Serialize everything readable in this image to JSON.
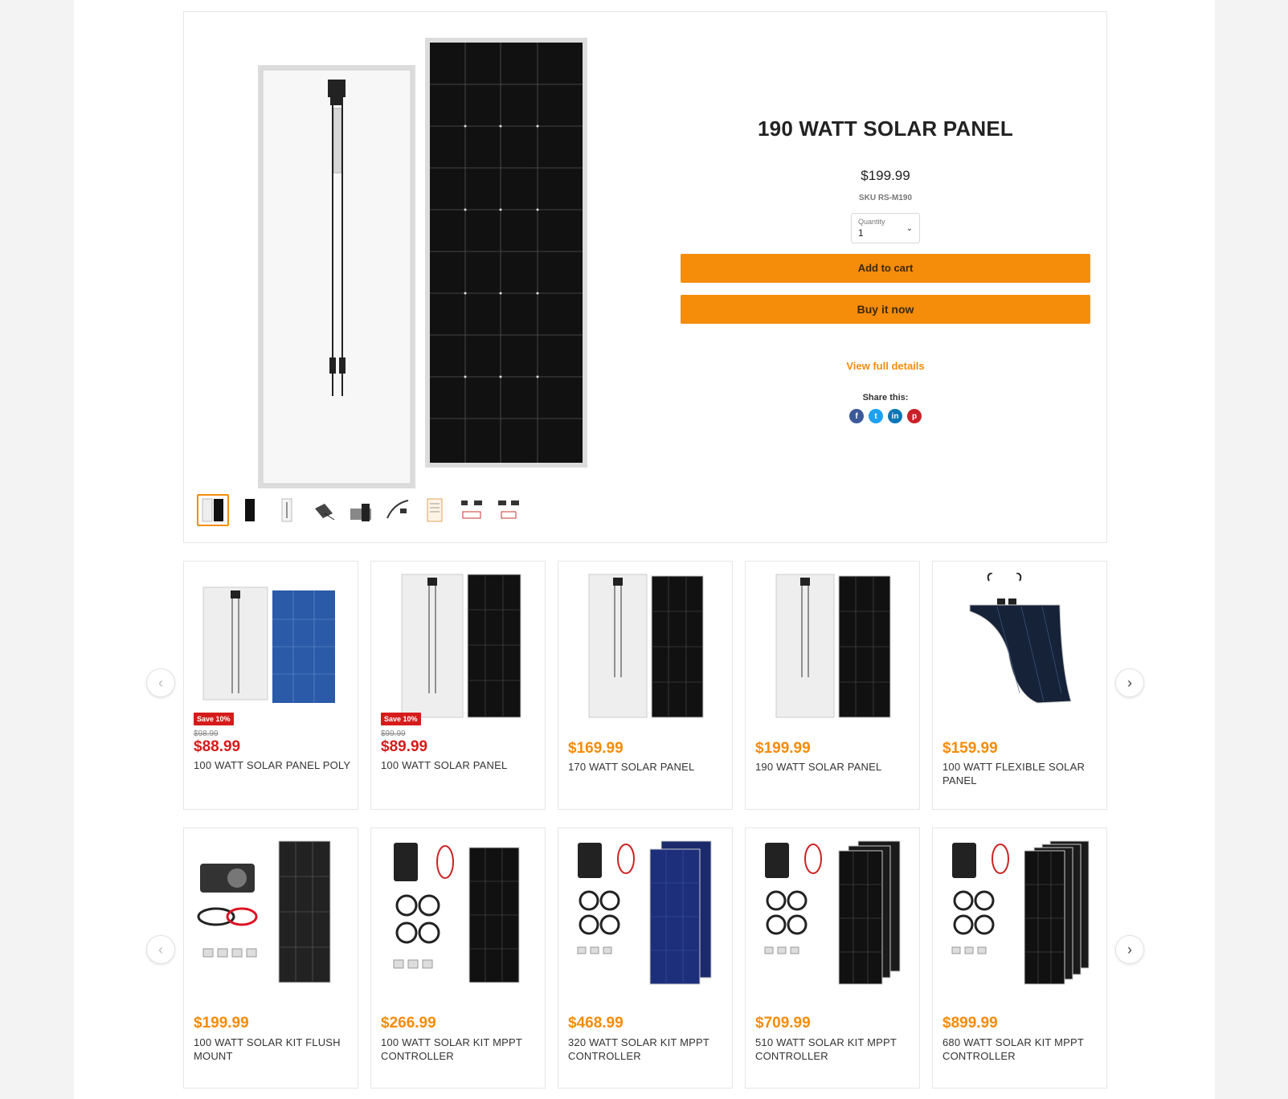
{
  "product": {
    "title": "190 WATT SOLAR PANEL",
    "price": "$199.99",
    "sku": "SKU RS-M190",
    "quantity_label": "Quantity",
    "quantity_value": "1",
    "add_to_cart": "Add to cart",
    "buy_now": "Buy it now",
    "view_details": "View full details",
    "share_label": "Share this:",
    "share_icons": [
      "facebook-icon",
      "twitter-icon",
      "linkedin-icon",
      "pinterest-icon"
    ]
  },
  "colors": {
    "accent": "#f58c0a",
    "sale": "#d61b1b",
    "facebook": "#3b5998",
    "twitter": "#1da1f2",
    "linkedin": "#0077b5",
    "pinterest": "#cb2027"
  },
  "carousel1": [
    {
      "badge": "Save 10%",
      "compare": "$98.99",
      "price": "$88.99",
      "name": "100 WATT SOLAR PANEL POLY"
    },
    {
      "badge": "Save 10%",
      "compare": "$99.99",
      "price": "$89.99",
      "name": "100 WATT SOLAR PANEL"
    },
    {
      "price": "$169.99",
      "name": "170 WATT SOLAR PANEL"
    },
    {
      "price": "$199.99",
      "name": "190 WATT SOLAR PANEL"
    },
    {
      "price": "$159.99",
      "name": "100 WATT FLEXIBLE SOLAR PANEL"
    }
  ],
  "carousel2": [
    {
      "price": "$199.99",
      "name": "100 WATT SOLAR KIT FLUSH MOUNT"
    },
    {
      "price": "$266.99",
      "name": "100 WATT SOLAR KIT MPPT CONTROLLER"
    },
    {
      "price": "$468.99",
      "name": "320 WATT SOLAR KIT MPPT CONTROLLER"
    },
    {
      "price": "$709.99",
      "name": "510 WATT SOLAR KIT MPPT CONTROLLER"
    },
    {
      "price": "$899.99",
      "name": "680 WATT SOLAR KIT MPPT CONTROLLER"
    }
  ]
}
